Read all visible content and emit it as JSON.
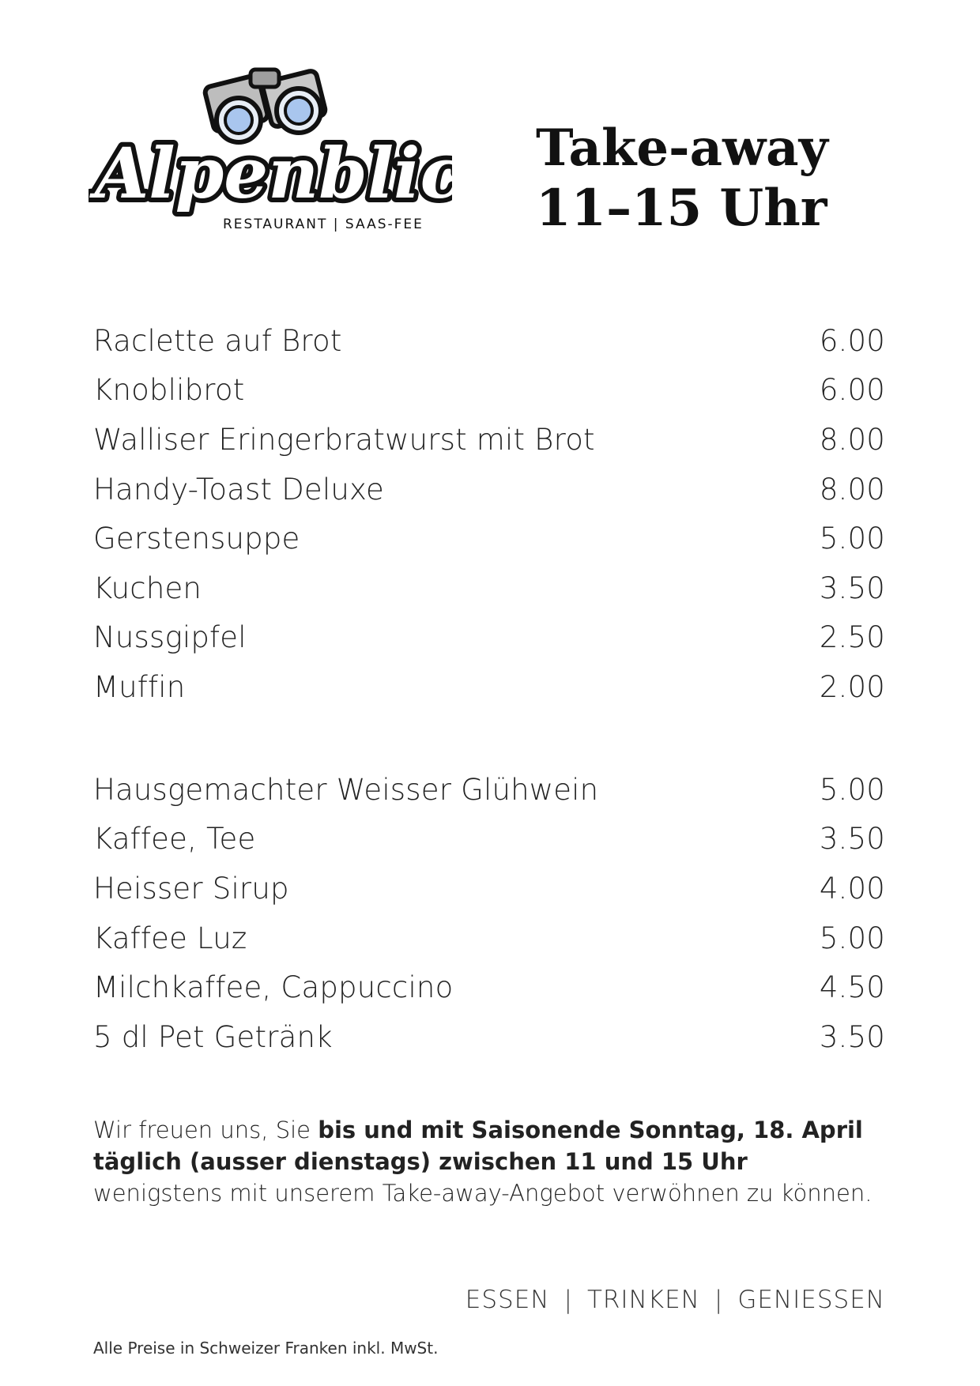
{
  "logo": {
    "icon": "binoculars-icon",
    "wordmark": "Alpenblick",
    "subtitle": "RESTAURANT | SAAS-FEE"
  },
  "heading": {
    "line1": "Take-away",
    "line2": "11–15 Uhr"
  },
  "food_items": [
    {
      "name": "Raclette auf Brot",
      "price": "6.00"
    },
    {
      "name": "Knoblibrot",
      "price": "6.00"
    },
    {
      "name": "Walliser Eringerbratwurst mit Brot",
      "price": "8.00"
    },
    {
      "name": "Handy-Toast Deluxe",
      "price": "8.00"
    },
    {
      "name": "Gerstensuppe",
      "price": "5.00"
    },
    {
      "name": "Kuchen",
      "price": "3.50"
    },
    {
      "name": "Nussgipfel",
      "price": "2.50"
    },
    {
      "name": "Muffin",
      "price": "2.00"
    }
  ],
  "drink_items": [
    {
      "name": "Hausgemachter Weisser Glühwein",
      "price": "5.00"
    },
    {
      "name": "Kaffee, Tee",
      "price": "3.50"
    },
    {
      "name": "Heisser Sirup",
      "price": "4.00"
    },
    {
      "name": "Kaffee Luz",
      "price": "5.00"
    },
    {
      "name": "Milchkaffee, Cappuccino",
      "price": "4.50"
    },
    {
      "name": "5 dl Pet Getränk",
      "price": "3.50"
    }
  ],
  "notice": {
    "intro": "Wir freuen uns, Sie ",
    "bold1": "bis und mit Saisonende Sonntag, 18. April",
    "bold2": "täglich (ausser dienstags) zwischen 11 und 15 Uhr",
    "end": "wenigstens mit unserem Take-away-Angebot verwöhnen zu können."
  },
  "slogan": [
    "ESSEN",
    "TRINKEN",
    "GENIESSEN"
  ],
  "footer": "Alle Preise in Schweizer Franken inkl. MwSt."
}
